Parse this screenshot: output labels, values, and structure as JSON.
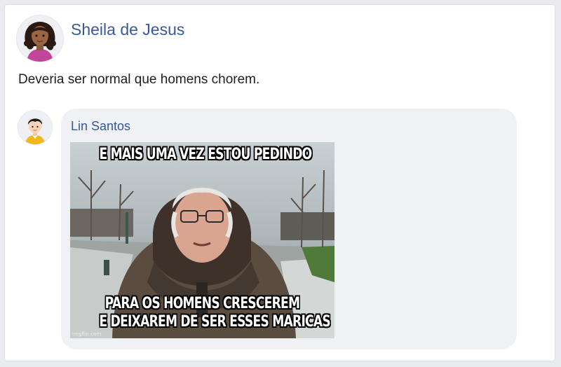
{
  "post": {
    "author": "Sheila de Jesus",
    "text": "Deveria ser normal que homens chorem.",
    "avatar_icon": "woman-avatar-icon"
  },
  "comment": {
    "author": "Lin Santos",
    "avatar_icon": "man-avatar-icon",
    "meme": {
      "top_text": "E MAIS UMA VEZ ESTOU PEDINDO",
      "bottom_text_line1": "PARA OS HOMENS CRESCEREM",
      "bottom_text_line2": "E DEIXAREM DE SER ESSES MARICAS",
      "watermark": "imgflip.com"
    }
  },
  "colors": {
    "link": "#385898",
    "text": "#1c1e21",
    "bubble": "#eff1f4",
    "page_bg": "#e9ebee"
  }
}
